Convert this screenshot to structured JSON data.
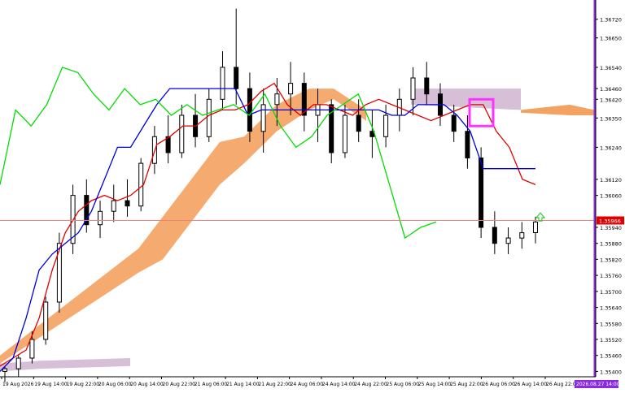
{
  "colors": {
    "background": "#ffffff",
    "bull_candle": "#ffffff",
    "bear_candle": "#000000",
    "candle_outline": "#000000",
    "tenkan": "#e00000",
    "kijun": "#0000dd",
    "chikou": "#00dd00",
    "kumo_bull": "#f4a261",
    "kumo_bear": "#d8bfd8",
    "price_line": "#f08080",
    "price_label_bg": "#e00000",
    "time_label_bg": "#8a2be2",
    "vertical_marker": "#8a2be2",
    "highlight_box": "#ff33ff",
    "arrow": "#33cc33",
    "axis_text": "#000000"
  },
  "chart_data": {
    "type": "candlestick",
    "instrument_pair_hint": "",
    "ylim": [
      1.3538,
      1.3678
    ],
    "y_ticks": [
      "1.36720",
      "1.36650",
      "1.36540",
      "1.36460",
      "1.36420",
      "1.36350",
      "1.36240",
      "1.36120",
      "1.36060",
      "1.35940",
      "1.35880",
      "1.35820",
      "1.35760",
      "1.35700",
      "1.35640",
      "1.35580",
      "1.35520",
      "1.35460",
      "1.35400"
    ],
    "x_ticks": [
      "19 Aug 2026",
      "19 Aug 14:00",
      "19 Aug 22:00",
      "20 Aug 06:00",
      "20 Aug 14:00",
      "20 Aug 22:00",
      "21 Aug 06:00",
      "21 Aug 14:00",
      "21 Aug 22:00",
      "24 Aug 06:00",
      "24 Aug 14:00",
      "24 Aug 22:00",
      "25 Aug 06:00",
      "25 Aug 14:00",
      "25 Aug 22:00",
      "26 Aug 06:00",
      "26 Aug 14:00",
      "26 Aug 22:00"
    ],
    "current_price_label": "1.35966",
    "current_price": 1.35966,
    "time_label": "2026.08.27 14:00",
    "grid": false,
    "series": [
      {
        "name": "",
        "kind": "tenkan",
        "values": [
          1.3542,
          1.3545,
          1.3548,
          1.356,
          1.3578,
          1.3592,
          1.36,
          1.3604,
          1.3606,
          1.3604,
          1.3606,
          1.361,
          1.3625,
          1.3628,
          1.3632,
          1.3632,
          1.3636,
          1.3638,
          1.3638,
          1.364,
          1.3645,
          1.3648,
          1.364,
          1.3636,
          1.364,
          1.364,
          1.3638,
          1.3636,
          1.364,
          1.3642,
          1.364,
          1.3638,
          1.3636,
          1.3634,
          1.3636,
          1.3638,
          1.364,
          1.364,
          1.363,
          1.3624,
          1.3612,
          1.361
        ]
      },
      {
        "name": "",
        "kind": "kijun",
        "values": [
          1.354,
          1.3545,
          1.356,
          1.3578,
          1.3584,
          1.3588,
          1.3592,
          1.36,
          1.3612,
          1.3624,
          1.3624,
          1.3632,
          1.364,
          1.3646,
          1.3646,
          1.3646,
          1.3646,
          1.3646,
          1.3646,
          1.3636,
          1.3638,
          1.3638,
          1.3638,
          1.3638,
          1.3638,
          1.3638,
          1.3638,
          1.3638,
          1.3638,
          1.3638,
          1.3636,
          1.3636,
          1.364,
          1.364,
          1.364,
          1.3636,
          1.363,
          1.3616,
          1.3616,
          1.3616,
          1.3616,
          1.3616
        ]
      },
      {
        "name": "",
        "kind": "chikou",
        "values": [
          1.361,
          1.3638,
          1.3632,
          1.364,
          1.3654,
          1.3652,
          1.3644,
          1.3638,
          1.3646,
          1.364,
          1.3642,
          1.3636,
          1.364,
          1.3636,
          1.3638,
          1.364,
          1.3636,
          1.3644,
          1.3632,
          1.3624,
          1.3628,
          1.3636,
          1.364,
          1.3644,
          1.363,
          1.361,
          1.359,
          1.3594,
          1.3596
        ]
      }
    ],
    "candles": [
      [
        1.354,
        1.3542,
        1.3536,
        1.3541
      ],
      [
        1.3541,
        1.3546,
        1.3538,
        1.3545
      ],
      [
        1.3545,
        1.3555,
        1.3543,
        1.3552
      ],
      [
        1.3552,
        1.3568,
        1.355,
        1.3566
      ],
      [
        1.3566,
        1.3592,
        1.3562,
        1.3588
      ],
      [
        1.3588,
        1.361,
        1.3584,
        1.3606
      ],
      [
        1.3606,
        1.3612,
        1.3592,
        1.3595
      ],
      [
        1.3595,
        1.3604,
        1.359,
        1.36
      ],
      [
        1.36,
        1.361,
        1.3596,
        1.3604
      ],
      [
        1.3604,
        1.3612,
        1.3598,
        1.3602
      ],
      [
        1.3602,
        1.362,
        1.36,
        1.3618
      ],
      [
        1.3618,
        1.3632,
        1.3614,
        1.3628
      ],
      [
        1.3628,
        1.3636,
        1.3618,
        1.3622
      ],
      [
        1.3622,
        1.364,
        1.362,
        1.3636
      ],
      [
        1.3636,
        1.3644,
        1.3624,
        1.3628
      ],
      [
        1.3628,
        1.3646,
        1.3626,
        1.3642
      ],
      [
        1.3642,
        1.366,
        1.3638,
        1.3654
      ],
      [
        1.3654,
        1.3676,
        1.364,
        1.3646
      ],
      [
        1.3646,
        1.3652,
        1.3626,
        1.363
      ],
      [
        1.363,
        1.3646,
        1.3622,
        1.364
      ],
      [
        1.364,
        1.365,
        1.3632,
        1.3644
      ],
      [
        1.3644,
        1.3656,
        1.3636,
        1.3648
      ],
      [
        1.3648,
        1.3652,
        1.363,
        1.3636
      ],
      [
        1.3636,
        1.3646,
        1.3626,
        1.364
      ],
      [
        1.364,
        1.3642,
        1.3618,
        1.3622
      ],
      [
        1.3622,
        1.364,
        1.362,
        1.3636
      ],
      [
        1.3636,
        1.3642,
        1.3626,
        1.363
      ],
      [
        1.363,
        1.3638,
        1.362,
        1.3628
      ],
      [
        1.3628,
        1.364,
        1.3624,
        1.3636
      ],
      [
        1.3636,
        1.3646,
        1.363,
        1.3642
      ],
      [
        1.3642,
        1.3654,
        1.3636,
        1.365
      ],
      [
        1.365,
        1.3656,
        1.364,
        1.3644
      ],
      [
        1.3644,
        1.3648,
        1.3632,
        1.3636
      ],
      [
        1.3636,
        1.364,
        1.3626,
        1.363
      ],
      [
        1.363,
        1.3636,
        1.3616,
        1.362
      ],
      [
        1.362,
        1.3624,
        1.359,
        1.3594
      ],
      [
        1.3594,
        1.36,
        1.3584,
        1.3588
      ],
      [
        1.3588,
        1.3594,
        1.3584,
        1.359
      ],
      [
        1.359,
        1.3596,
        1.3586,
        1.3592
      ],
      [
        1.3592,
        1.3598,
        1.3588,
        1.3596
      ]
    ]
  }
}
